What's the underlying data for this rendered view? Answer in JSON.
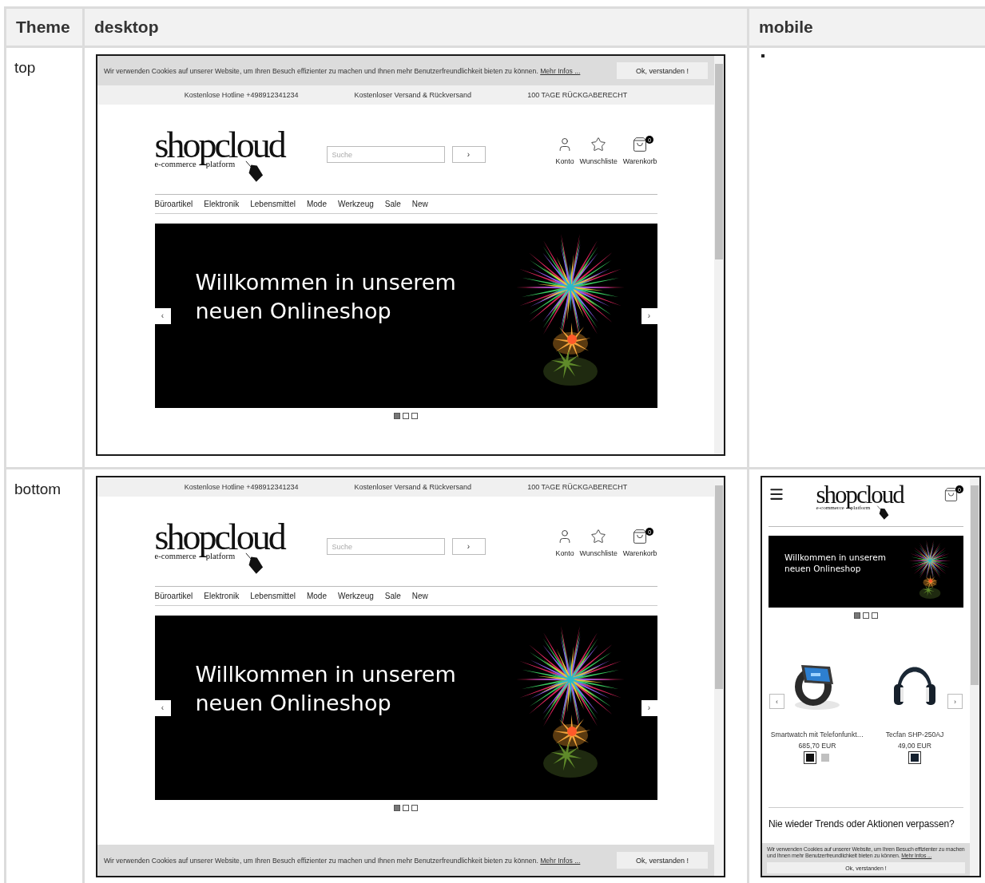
{
  "table": {
    "columns": [
      "Theme",
      "desktop",
      "mobile"
    ],
    "rows": [
      {
        "theme": "top",
        "desktop": {
          "cookie_banner": {
            "overlay": false,
            "text": "Wir verwenden Cookies auf unserer Website, um Ihren Besuch effizienter zu machen und Ihnen mehr Benutzerfreundlichkeit bieten zu können.",
            "link": "Mehr Infos ...",
            "button": "Ok, verstanden !"
          },
          "top_bar": [
            "Kostenlose Hotline +498912341234",
            "Kostenloser Versand & Rückversand",
            "100 TAGE RÜCKGABERECHT"
          ],
          "logo": {
            "name": "shopcloud",
            "tagline_left": "e-commerce",
            "tagline_right": "platform"
          },
          "search": {
            "placeholder": "Suche",
            "button": "›"
          },
          "header_links": [
            {
              "kind": "account",
              "label": "Konto"
            },
            {
              "kind": "wishlist",
              "label": "Wunschliste"
            },
            {
              "kind": "cart",
              "label": "Warenkorb",
              "badge": "0"
            }
          ],
          "nav": [
            "Büroartikel",
            "Elektronik",
            "Lebensmittel",
            "Mode",
            "Werkzeug",
            "Sale",
            "New"
          ],
          "hero": {
            "lines": [
              "Willkommen in unserem",
              "neuen Onlineshop"
            ],
            "prev": "‹",
            "next": "›"
          },
          "slides": [
            {
              "selected": true
            },
            {
              "selected": false
            },
            {
              "selected": false
            }
          ]
        },
        "mobile": {
          "kind": "placeholder"
        }
      },
      {
        "theme": "bottom",
        "desktop": {
          "cookie_banner": {
            "overlay": true,
            "text": "Wir verwenden Cookies auf unserer Website, um Ihren Besuch effizienter zu machen und Ihnen mehr Benutzerfreundlichkeit bieten zu können.",
            "link": "Mehr Infos ...",
            "button": "Ok, verstanden !"
          },
          "top_bar": [
            "Kostenlose Hotline +498912341234",
            "Kostenloser Versand & Rückversand",
            "100 TAGE RÜCKGABERECHT"
          ],
          "logo": {
            "name": "shopcloud",
            "tagline_left": "e-commerce",
            "tagline_right": "platform"
          },
          "search": {
            "placeholder": "Suche",
            "button": "›"
          },
          "header_links": [
            {
              "kind": "account",
              "label": "Konto"
            },
            {
              "kind": "wishlist",
              "label": "Wunschliste"
            },
            {
              "kind": "cart",
              "label": "Warenkorb",
              "badge": "0"
            }
          ],
          "nav": [
            "Büroartikel",
            "Elektronik",
            "Lebensmittel",
            "Mode",
            "Werkzeug",
            "Sale",
            "New"
          ],
          "hero": {
            "lines": [
              "Willkommen in unserem",
              "neuen Onlineshop"
            ],
            "prev": "‹",
            "next": "›"
          },
          "slides": [
            {
              "selected": true
            },
            {
              "selected": false
            },
            {
              "selected": false
            }
          ]
        },
        "mobile": {
          "kind": "screenshot",
          "logo": {
            "name": "shopcloud",
            "tagline_left": "e-commerce",
            "tagline_right": "platform"
          },
          "cart_badge": "0",
          "hero": {
            "lines": [
              "Willkommen in unserem",
              "neuen Onlineshop"
            ]
          },
          "slides": [
            {
              "selected": true
            },
            {
              "selected": false
            },
            {
              "selected": false
            }
          ],
          "carousel": {
            "prev": "‹",
            "next": "›"
          },
          "products": [
            {
              "kind": "watch",
              "name": "Smartwatch mit Telefonfunkt…",
              "price": "685,70 EUR",
              "swatches": [
                {
                  "color": "#111111",
                  "selected": true
                },
                {
                  "color": "#c0c0c0",
                  "selected": false
                }
              ]
            },
            {
              "kind": "headphones",
              "name": "Tecfan SHP-250AJ",
              "price": "49,00 EUR",
              "swatches": [
                {
                  "color": "#14202e",
                  "selected": true
                }
              ]
            }
          ],
          "newsletter_heading": "Nie wieder Trends oder Aktionen verpassen?",
          "cookie_banner": {
            "text": "Wir verwenden Cookies auf unserer Website, um Ihren Besuch effizienter zu machen und Ihnen mehr Benutzerfreundlichkeit bieten zu können.",
            "link": "Mehr Infos ...",
            "button": "Ok, verstanden !"
          }
        }
      }
    ]
  }
}
